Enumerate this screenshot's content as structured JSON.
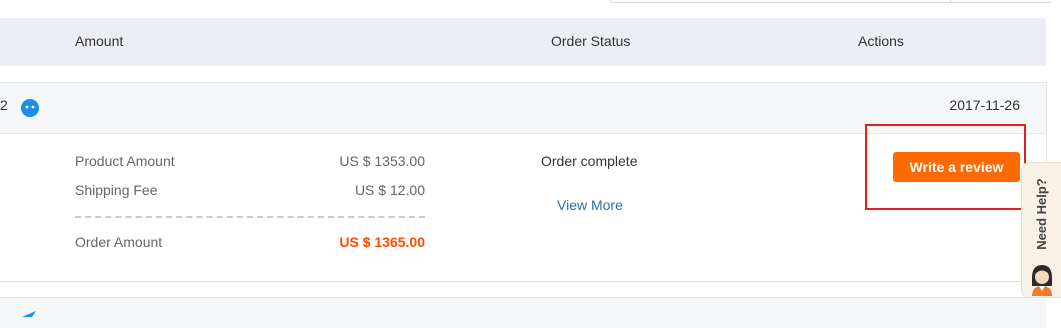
{
  "table_header": {
    "amount": "Amount",
    "order_status": "Order Status",
    "actions": "Actions"
  },
  "order": {
    "order_no_suffix": "2",
    "date": "2017-11-26",
    "product_amount_label": "Product Amount",
    "product_amount_value": "US $ 1353.00",
    "shipping_fee_label": "Shipping Fee",
    "shipping_fee_value": "US $ 12.00",
    "order_amount_label": "Order Amount",
    "order_amount_value": "US $ 1365.00",
    "status": "Order complete",
    "view_more": "View More",
    "write_review": "Write a review"
  },
  "help": {
    "label": "Need Help?"
  },
  "colors": {
    "accent": "#ff6a00",
    "total_price": "#ff4a00",
    "link": "#2a6fb0",
    "header_bg": "#eceef3",
    "highlight": "#e02020",
    "badge": "#1a8fe3"
  },
  "icons": {
    "badge": "round-blue-badge-icon",
    "next_row": "blue-triangle-icon",
    "help_avatar": "support-agent-avatar-icon"
  }
}
